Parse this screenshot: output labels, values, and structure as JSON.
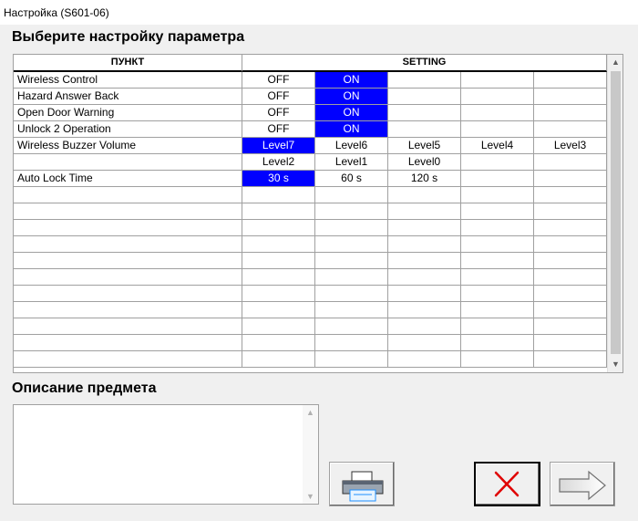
{
  "window": {
    "title": "Настройка (S601-06)"
  },
  "main": {
    "heading": "Выберите настройку параметра"
  },
  "grid": {
    "headers": {
      "item": "ПУНКТ",
      "setting": "SETTING"
    },
    "rows": [
      {
        "item": "Wireless Control",
        "values": [
          "OFF",
          "ON",
          "",
          "",
          ""
        ],
        "selected": 1
      },
      {
        "item": "Hazard Answer Back",
        "values": [
          "OFF",
          "ON",
          "",
          "",
          ""
        ],
        "selected": 1
      },
      {
        "item": "Open Door Warning",
        "values": [
          "OFF",
          "ON",
          "",
          "",
          ""
        ],
        "selected": 1
      },
      {
        "item": "Unlock 2 Operation",
        "values": [
          "OFF",
          "ON",
          "",
          "",
          ""
        ],
        "selected": 1
      },
      {
        "item": "Wireless Buzzer Volume",
        "values": [
          "Level7",
          "Level6",
          "Level5",
          "Level4",
          "Level3"
        ],
        "selected": 0
      },
      {
        "item": "",
        "values": [
          "Level2",
          "Level1",
          "Level0",
          "",
          ""
        ],
        "selected": -1
      },
      {
        "item": "Auto Lock Time",
        "values": [
          "30 s",
          "60 s",
          "120 s",
          "",
          ""
        ],
        "selected": 0
      },
      {
        "item": "",
        "values": [
          "",
          "",
          "",
          "",
          ""
        ],
        "selected": -1
      },
      {
        "item": "",
        "values": [
          "",
          "",
          "",
          "",
          ""
        ],
        "selected": -1
      },
      {
        "item": "",
        "values": [
          "",
          "",
          "",
          "",
          ""
        ],
        "selected": -1
      },
      {
        "item": "",
        "values": [
          "",
          "",
          "",
          "",
          ""
        ],
        "selected": -1
      },
      {
        "item": "",
        "values": [
          "",
          "",
          "",
          "",
          ""
        ],
        "selected": -1
      },
      {
        "item": "",
        "values": [
          "",
          "",
          "",
          "",
          ""
        ],
        "selected": -1
      },
      {
        "item": "",
        "values": [
          "",
          "",
          "",
          "",
          ""
        ],
        "selected": -1
      },
      {
        "item": "",
        "values": [
          "",
          "",
          "",
          "",
          ""
        ],
        "selected": -1
      },
      {
        "item": "",
        "values": [
          "",
          "",
          "",
          "",
          ""
        ],
        "selected": -1
      },
      {
        "item": "",
        "values": [
          "",
          "",
          "",
          "",
          ""
        ],
        "selected": -1
      },
      {
        "item": "",
        "values": [
          "",
          "",
          "",
          "",
          ""
        ],
        "selected": -1
      }
    ]
  },
  "description": {
    "heading": "Описание предмета",
    "text": ""
  },
  "buttons": {
    "print_icon": "printer-icon",
    "cancel_icon": "red-x-icon",
    "next_icon": "right-arrow-icon"
  },
  "colors": {
    "selected_bg": "#0000ff",
    "selected_fg": "#ffffff",
    "cancel_x": "#e00000"
  }
}
